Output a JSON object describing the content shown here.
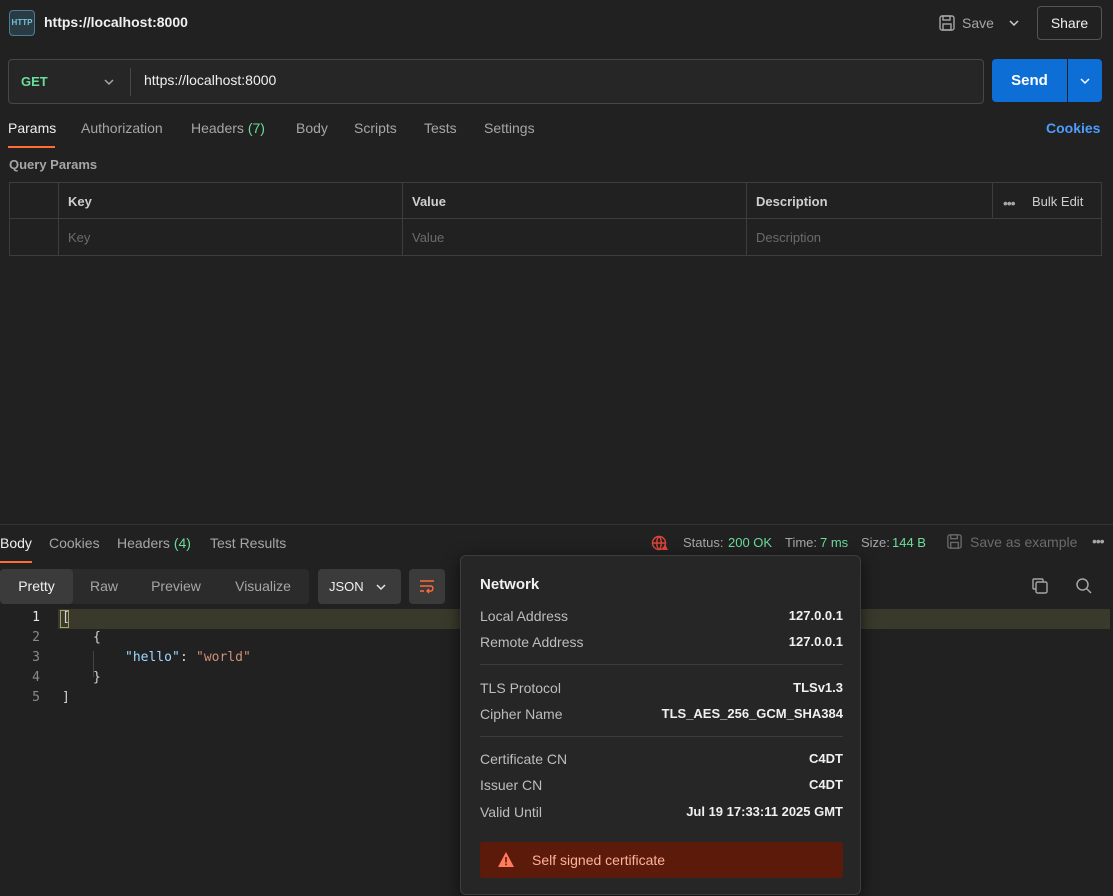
{
  "header": {
    "icon_text": "HTTP",
    "request_title": "https://localhost:8000",
    "save_label": "Save",
    "share_label": "Share"
  },
  "request": {
    "method": "GET",
    "url": "https://localhost:8000",
    "send_label": "Send",
    "tabs": [
      {
        "label": "Params"
      },
      {
        "label": "Authorization"
      },
      {
        "label": "Headers",
        "count": "(7)"
      },
      {
        "label": "Body"
      },
      {
        "label": "Scripts"
      },
      {
        "label": "Tests"
      },
      {
        "label": "Settings"
      }
    ],
    "cookies_label": "Cookies"
  },
  "params": {
    "section_label": "Query Params",
    "columns": [
      "Key",
      "Value",
      "Description"
    ],
    "bulk_edit_label": "Bulk Edit",
    "placeholders": [
      "Key",
      "Value",
      "Description"
    ]
  },
  "response": {
    "tabs": [
      {
        "label": "Body"
      },
      {
        "label": "Cookies"
      },
      {
        "label": "Headers",
        "count": "(4)"
      },
      {
        "label": "Test Results"
      }
    ],
    "status_label": "Status:",
    "status_value": "200 OK",
    "time_label": "Time:",
    "time_value": "7 ms",
    "size_label": "Size:",
    "size_value": "144 B",
    "save_example_label": "Save as example",
    "view_modes": [
      "Pretty",
      "Raw",
      "Preview",
      "Visualize"
    ],
    "format": "JSON",
    "code": {
      "line_numbers": [
        "1",
        "2",
        "3",
        "4",
        "5"
      ],
      "open_bracket": "[",
      "open_brace": "{",
      "key": "\"hello\"",
      "colon": ": ",
      "value": "\"world\"",
      "close_brace": "}",
      "close_bracket": "]"
    }
  },
  "network": {
    "title": "Network",
    "local_address_label": "Local Address",
    "local_address": "127.0.0.1",
    "remote_address_label": "Remote Address",
    "remote_address": "127.0.0.1",
    "tls_protocol_label": "TLS Protocol",
    "tls_protocol": "TLSv1.3",
    "cipher_name_label": "Cipher Name",
    "cipher_name": "TLS_AES_256_GCM_SHA384",
    "certificate_cn_label": "Certificate CN",
    "certificate_cn": "C4DT",
    "issuer_cn_label": "Issuer CN",
    "issuer_cn": "C4DT",
    "valid_until_label": "Valid Until",
    "valid_until": "Jul 19 17:33:11 2025 GMT",
    "warning": "Self signed certificate"
  },
  "colors": {
    "accent": "#ff6c37",
    "send": "#0d6ed6",
    "success": "#6bdd9a",
    "link": "#4c9dfc",
    "warning_bg": "#5c1a0b"
  }
}
